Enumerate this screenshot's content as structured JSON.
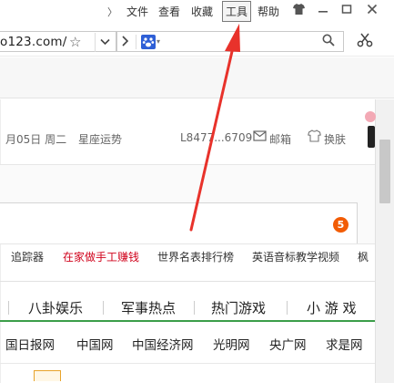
{
  "menubar": {
    "expand_glyph": "〉",
    "items": [
      "文件",
      "查看",
      "收藏",
      "工具",
      "帮助"
    ],
    "highlighted_item": "工具",
    "window_controls": {
      "skin": "shirt-icon",
      "minimize": "minimize-icon",
      "maximize": "maximize-icon",
      "close": "close-icon"
    }
  },
  "addressbar": {
    "url": "o123.com/",
    "search_engine_icon": "paw-icon"
  },
  "page": {
    "infobar": {
      "date": "月05日 周二",
      "horoscope": "星座运势",
      "user": "L8477...6709",
      "mail": "邮箱",
      "skin": "换肤"
    },
    "badge_count": "5",
    "hotlinks": [
      "追踪器",
      "在家做手工赚钱",
      "世界名表排行榜",
      "英语音标教学视频",
      "枫"
    ],
    "categories": [
      "八卦娱乐",
      "军事热点",
      "热门游戏",
      "小 游 戏"
    ],
    "sites": [
      "国日报网",
      "中国网",
      "中国经济网",
      "光明网",
      "央广网",
      "求是网"
    ]
  },
  "colors": {
    "annotation_arrow": "#e8322b",
    "accent_green": "#3c9e4a",
    "badge_orange": "#f25c05",
    "promo_red": "#d0021b"
  }
}
